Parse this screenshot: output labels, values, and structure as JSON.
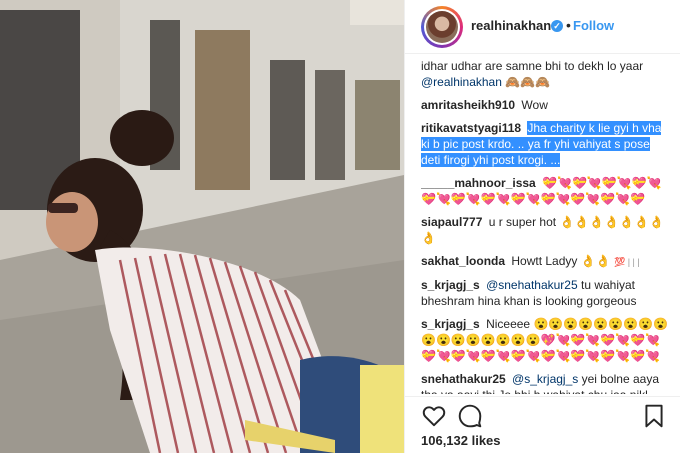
{
  "header": {
    "username": "realhinakhan",
    "verified_mark": "✓",
    "separator": "•",
    "follow_label": "Follow"
  },
  "comments": [
    {
      "user": "",
      "text": "idhar udhar are samne bhi to dekh lo yaar",
      "mention": "@realhinakhan",
      "emojis": "🙈🙈🙈"
    },
    {
      "user": "amritasheikh910",
      "text": "Wow"
    },
    {
      "user": "ritikavatstyagi118",
      "text_highlighted": "Jha charity k lie gyi h vha ki b pic post krdo. .. ya fr yhi vahiyat s pose deti firogi yhi post krogi. ..."
    },
    {
      "user": "_____mahnoor_issa",
      "emojis": "💝💘💝💘💝💘💝💘💝💘💝💘💝💘💝💘💝💘💝💘💝💘💝"
    },
    {
      "user": "siapaul777",
      "text": "u r super hot",
      "emojis": "👌👌👌👌👌👌👌👌"
    },
    {
      "user": "sakhat_loonda",
      "text": "Howtt Ladyy",
      "emojis": "👌👌",
      "extra": "💯 | | |"
    },
    {
      "user": "s_krjagj_s",
      "mention": "@snehathakur25",
      "text": "tu wahiyat bheshram hina khan is looking gorgeous"
    },
    {
      "user": "s_krjagj_s",
      "text": "Niceeee",
      "emojis": "😮😮😮😮😮😮😮😮😮😮😮😮😮😮😮😮😮💖💘💝💘💝💘💝💘💝💘💝💘💝💘💝💘💝💘💝💘💝💘💝💘"
    },
    {
      "user": "snehathakur25",
      "mention": "@s_krjagj_s",
      "text": "yei bolne aaya tha ya aayi thi Jo bhi h wahiyat chu jaa nikl"
    }
  ],
  "actions": {
    "like_icon": "heart-icon",
    "comment_icon": "comment-icon",
    "save_icon": "bookmark-icon"
  },
  "likes_label": "106,132 likes",
  "colors": {
    "accent": "#3897f0",
    "highlight": "#3390ff",
    "text": "#262626",
    "border": "#efefef"
  }
}
